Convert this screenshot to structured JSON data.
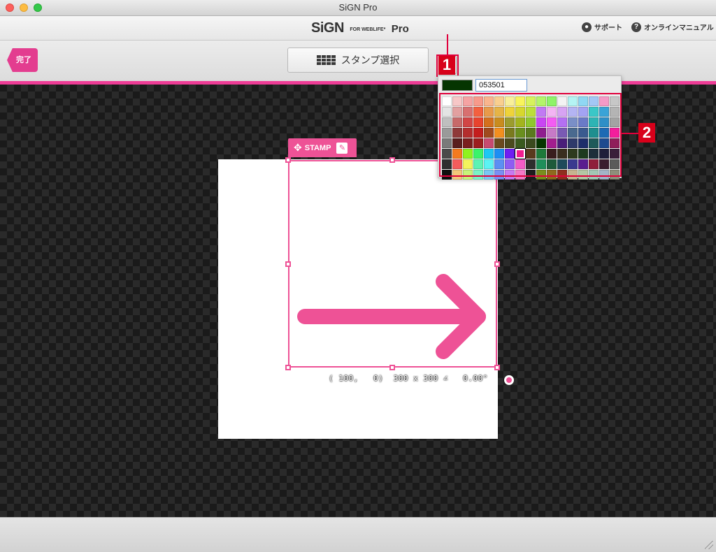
{
  "window": {
    "title": "SiGN Pro"
  },
  "header": {
    "logo_main": "SiGN",
    "logo_sub": "FOR WEBLIFE*",
    "logo_pro": "Pro",
    "support_label": "サポート",
    "manual_label": "オンラインマニュアル"
  },
  "toolbar": {
    "done_label": "完了",
    "stamp_select_label": "スタンプ選択",
    "current_color": "#ee5296"
  },
  "callouts": {
    "one": "1",
    "two": "2"
  },
  "stamp": {
    "tag_label": "STAMP",
    "color": "#ee5296",
    "coords_text": "( 100,   0)  300 x 300 ∠   0.00°"
  },
  "color_picker": {
    "preview_color": "#053501",
    "hex_value": "053501",
    "selected_index": 92,
    "palette": [
      "#ffffff",
      "#f7c7c7",
      "#f5a3a3",
      "#f79a8b",
      "#f9b58e",
      "#f9cf8f",
      "#f8ef9a",
      "#f8f45c",
      "#d7f35c",
      "#b4f56a",
      "#8ff36a",
      "#f3f3f3",
      "#b4f3f3",
      "#8fd7f3",
      "#a3c7f5",
      "#f59ac7",
      "#c7c7c7",
      "#e4e4e4",
      "#e2a0a0",
      "#d87070",
      "#f3603f",
      "#e89a4a",
      "#e6b446",
      "#efd33a",
      "#d7d72e",
      "#bcdf3a",
      "#c17af3",
      "#f3b4f3",
      "#d7a3f3",
      "#b4b4f3",
      "#a3a3f3",
      "#3ac7c7",
      "#3aa3d7",
      "#b4b4b4",
      "#bfbfbf",
      "#c76a6a",
      "#d24545",
      "#e8432e",
      "#d4701e",
      "#c98c1e",
      "#9c9c2e",
      "#a3b41e",
      "#8fc72e",
      "#c946f3",
      "#f35cf3",
      "#b470f3",
      "#7a8fc7",
      "#6a7ac7",
      "#2eb4b4",
      "#2e8fc7",
      "#a3a3a3",
      "#9a9a9a",
      "#8f3a3a",
      "#b42e2e",
      "#c41e1e",
      "#a04a1e",
      "#f38f1e",
      "#7a7a1e",
      "#6a8f1e",
      "#5a7a1e",
      "#8f1e8f",
      "#c77ac7",
      "#7a5ab4",
      "#4a6a8f",
      "#3a5a8f",
      "#1e8f8f",
      "#1e6ab4",
      "#f31e9c",
      "#7a7a7a",
      "#5a1e1e",
      "#7a1e1e",
      "#9c1e1e",
      "#c74a70",
      "#6a4a1e",
      "#4a4a1e",
      "#3a5a1e",
      "#3a4a1e",
      "#053501",
      "#a31e8f",
      "#4a1e7a",
      "#2e3a6a",
      "#1e2e6a",
      "#1e5a5a",
      "#1e4a8f",
      "#8f1e5a",
      "#4a4a4a",
      "#f37a1e",
      "#8ff31e",
      "#3af36a",
      "#1ec7f3",
      "#1e8ff3",
      "#701ef3",
      "#f31e8f",
      "#5a3a1e",
      "#1e7a3a",
      "#3a1e1e",
      "#3a2e1e",
      "#2e3a1e",
      "#1e3a1e",
      "#1e2e3a",
      "#1e1e3a",
      "#3a1e3a",
      "#2e2e2e",
      "#f35c5c",
      "#f3f35c",
      "#5cf3b4",
      "#5cf3f3",
      "#5c8ff3",
      "#8f5cf3",
      "#f35cc7",
      "#2e2e2e",
      "#1e8f5a",
      "#1e5a3a",
      "#1e4a5a",
      "#3a3a8f",
      "#5a1e8f",
      "#8f1e3a",
      "#3a1e2e",
      "#5a5a5a",
      "#0f0f0f",
      "#f3c77a",
      "#c7f37a",
      "#7af3c7",
      "#7ac7f3",
      "#7a8ff3",
      "#c77af3",
      "#f37ac7",
      "#1e1e1e",
      "#7a8f1e",
      "#8f6a1e",
      "#8f2e1e",
      "#c7b48f",
      "#b4c7a3",
      "#a3c7b4",
      "#a3b4c7",
      "#8f8f7a"
    ]
  }
}
